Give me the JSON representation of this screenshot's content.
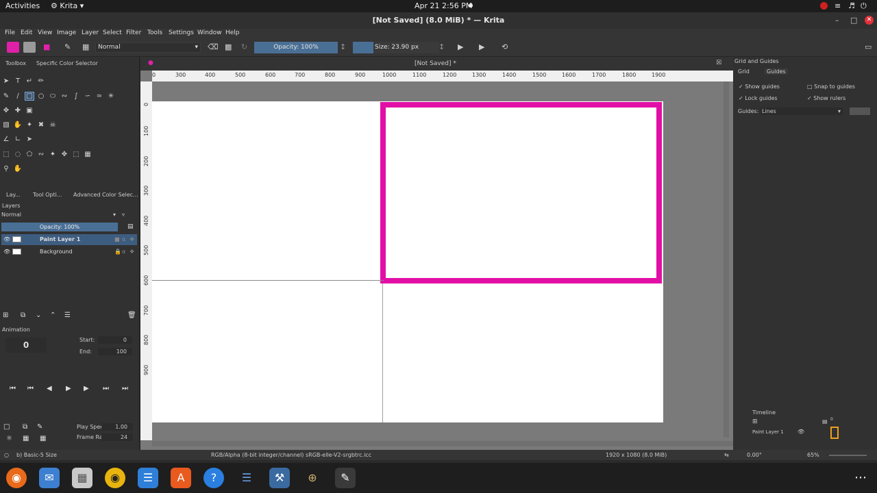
{
  "system_bar": {
    "activities": "Activities",
    "app_name": "Krita",
    "datetime": "Apr 21  2:56 PM"
  },
  "window": {
    "title": "[Not Saved]  (8.0 MiB)  * — Krita"
  },
  "menu": [
    "File",
    "Edit",
    "View",
    "Image",
    "Layer",
    "Select",
    "Filter",
    "Tools",
    "Settings",
    "Window",
    "Help"
  ],
  "toolbar": {
    "blend_mode": "Normal",
    "opacity": "Opacity: 100%",
    "size": "Size: 23.90 px",
    "fg_color": "#e020a8",
    "bg_color": "#9a9a9a"
  },
  "left_docker": {
    "tabs_top": [
      "Toolbox",
      "Specific Color Selector"
    ],
    "tabs_mid": [
      "Lay...",
      "Tool Opti...",
      "Advanced Color Selec..."
    ],
    "layers_title": "Layers",
    "layer_blend": "Normal",
    "layer_opacity": "Opacity:  100%",
    "layers": [
      {
        "name": "Paint Layer 1",
        "selected": true
      },
      {
        "name": "Background",
        "selected": false
      }
    ]
  },
  "animation": {
    "title": "Animation",
    "current_frame": "0",
    "start_label": "Start:",
    "start_value": "0",
    "end_label": "End:",
    "end_value": "100",
    "play_speed_label": "Play Speed:",
    "play_speed_value": "1.00",
    "frame_rate_label": "Frame Rate:",
    "frame_rate_value": "24"
  },
  "canvas": {
    "doc_tab": "[Not Saved]  *",
    "h_ruler": [
      "0",
      "300",
      "400",
      "500",
      "600",
      "700",
      "800",
      "900",
      "1000",
      "1100",
      "1200",
      "1300",
      "1400",
      "1500",
      "1600",
      "1700",
      "1800",
      "1900"
    ],
    "v_ruler": [
      "0",
      "100",
      "200",
      "300",
      "400",
      "500",
      "600",
      "700",
      "800",
      "900"
    ],
    "shape_color": "#e20fa6"
  },
  "right_docker": {
    "title": "Grid and Guides",
    "tabs": [
      "Grid",
      "Guides"
    ],
    "show_guides": "Show guides",
    "snap_to_guides": "Snap to guides",
    "lock_guides": "Lock guides",
    "show_rulers": "Show rulers",
    "guides_label": "Guides:",
    "guides_type": "Lines",
    "timeline_title": "Timeline",
    "timeline_layer": "Paint Layer 1",
    "timeline_frame": "0"
  },
  "status": {
    "brush": "b) Basic-5 Size",
    "color_space": "RGB/Alpha (8-bit integer/channel)  sRGB-elle-V2-srgbtrc.icc",
    "image_size": "1920 x 1080 (8.0 MiB)",
    "rotation": "0.00°",
    "zoom": "65%"
  }
}
